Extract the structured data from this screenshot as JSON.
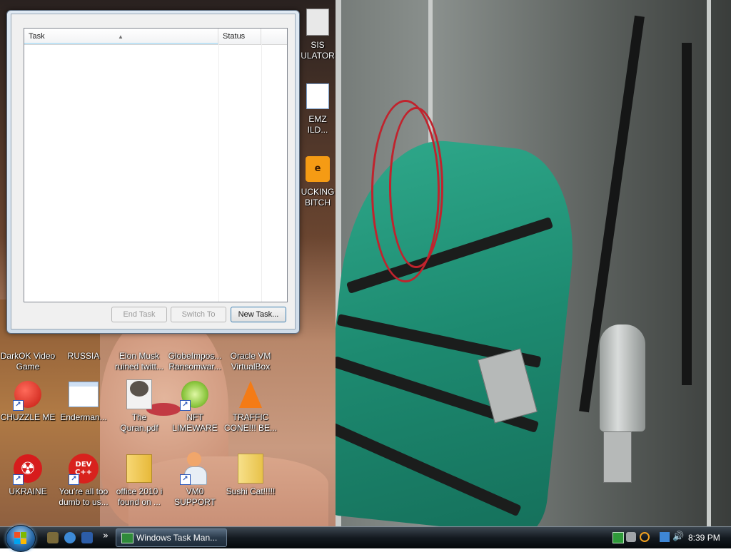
{
  "window": {
    "columns": {
      "task": "Task",
      "status": "Status"
    },
    "buttons": {
      "end_task": "End Task",
      "switch_to": "Switch To",
      "new_task": "New Task..."
    }
  },
  "desktop_icons": [
    {
      "label": "SIS\nULATOR",
      "icon": "app-icon"
    },
    {
      "label": "EMZ\nILD...",
      "icon": "document-icon"
    },
    {
      "label": "UCKING\nBITCH",
      "icon": "after-effects-icon"
    },
    {
      "label": "DarkOK Video\nGame",
      "icon": "game-icon"
    },
    {
      "label": "RUSSIA",
      "icon": "folder-icon"
    },
    {
      "label": "Elon Musk\nruined twitt...",
      "icon": "document-icon"
    },
    {
      "label": "GlobeImpos...\nRansomwar...",
      "icon": "app-icon"
    },
    {
      "label": "Oracle VM\nVirtualBox",
      "icon": "virtualbox-icon"
    },
    {
      "label": "CHUZZLE ME",
      "icon": "chuzzle-icon"
    },
    {
      "label": "Enderman...",
      "icon": "document-icon"
    },
    {
      "label": "The\nQuran.pdf",
      "icon": "raccoon-pdf-icon"
    },
    {
      "label": "NFT\nLIMEWARE",
      "icon": "limewire-icon"
    },
    {
      "label": "TRAFFIC\nCONE!!! BE...",
      "icon": "traffic-cone-icon"
    },
    {
      "label": "UKRAINE",
      "icon": "radiation-icon"
    },
    {
      "label": "You're all too\ndumb to us...",
      "icon": "devcpp-icon"
    },
    {
      "label": "office 2010 i\nfound on ...",
      "icon": "folder-icon"
    },
    {
      "label": "VM0\nSUPPORT",
      "icon": "support-person-icon"
    },
    {
      "label": "Sushi Cat!!!!!",
      "icon": "folder-icon"
    }
  ],
  "devcpp_badge": "DEV\nC++",
  "taskbar": {
    "task_button": "Windows Task Man...",
    "clock": "8:39 PM"
  },
  "colors": {
    "taskbar_top": "#3c4650",
    "window_frame": "#dfe9f3",
    "header_sort_highlight": "#bfe3f6"
  }
}
